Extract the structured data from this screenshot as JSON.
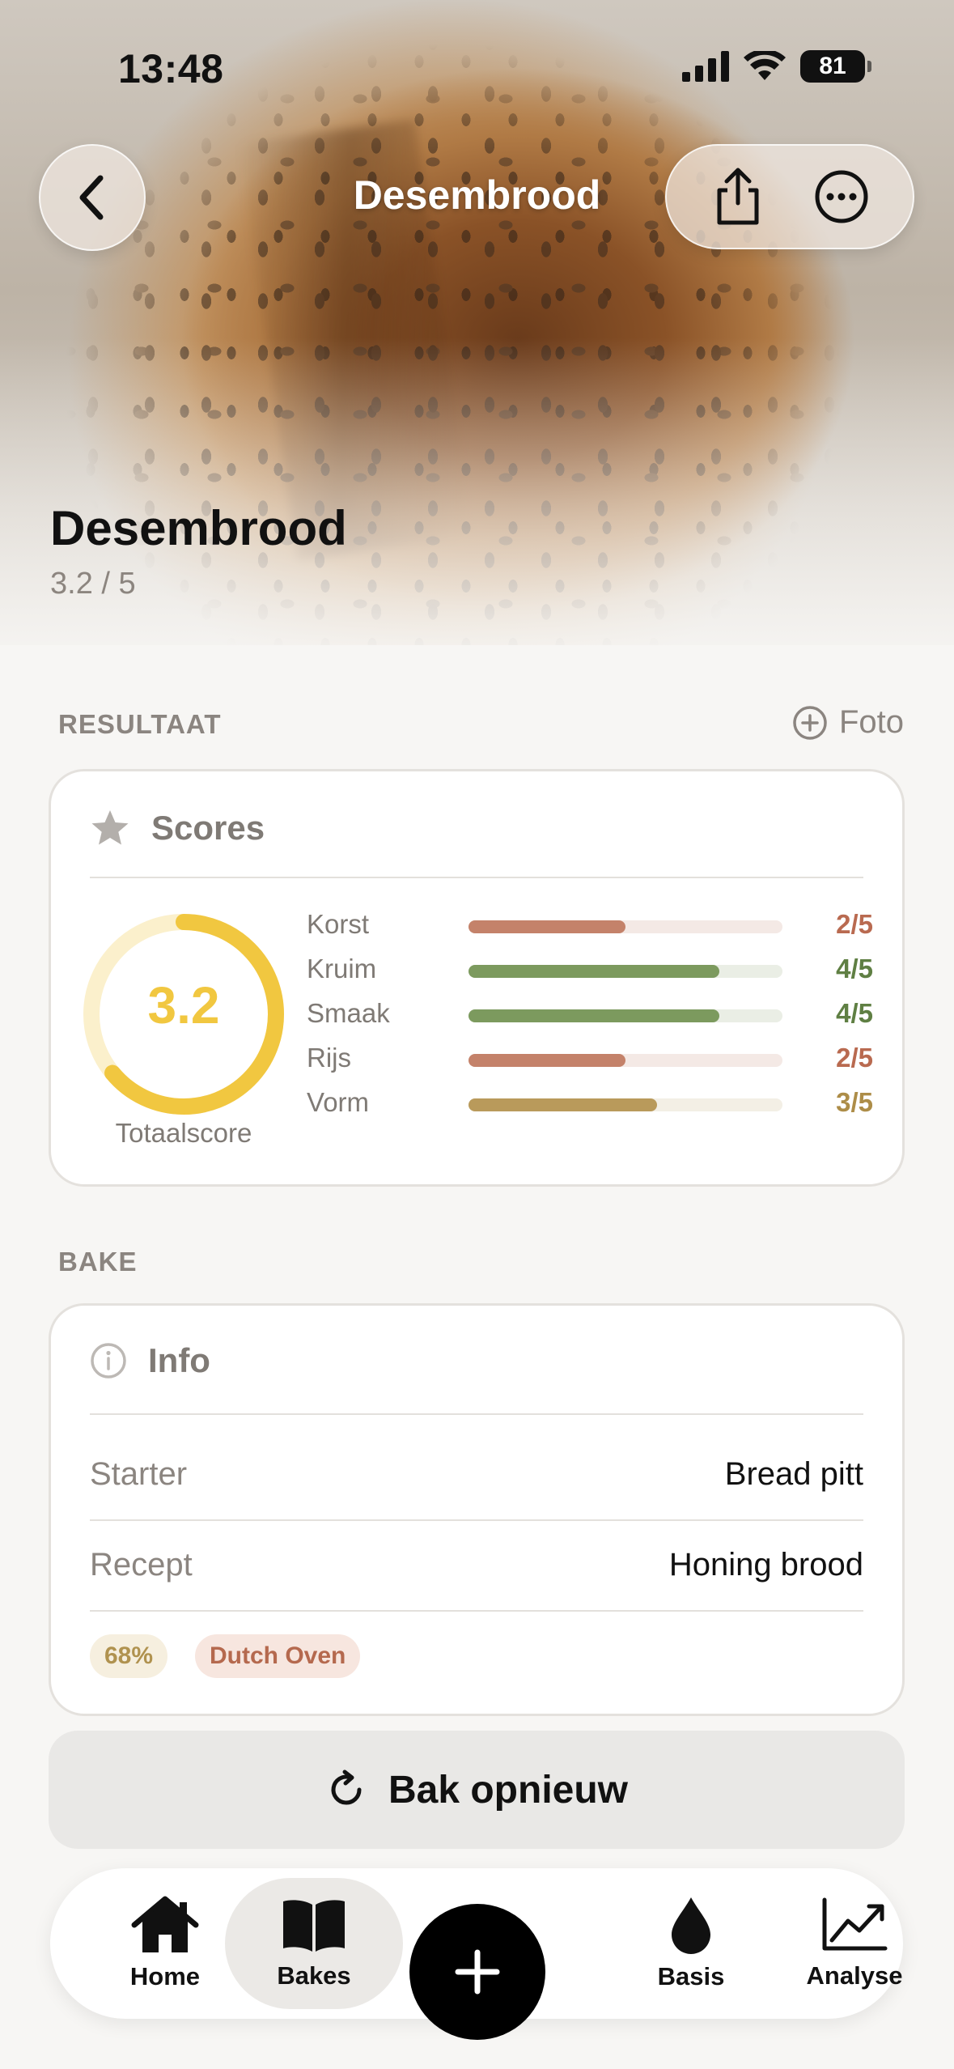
{
  "status_bar": {
    "time": "13:48",
    "battery": "81"
  },
  "nav": {
    "title": "Desembrood"
  },
  "hero": {
    "title": "Desembrood",
    "subtitle": "3.2 / 5"
  },
  "result_section": {
    "label": "RESULTAAT",
    "foto_label": "Foto",
    "scores_card": {
      "title": "Scores",
      "total": "3.2",
      "total_fraction": 0.64,
      "total_label": "Totaalscore",
      "rows": [
        {
          "name": "Korst",
          "value": "2/5",
          "fraction": 0.5,
          "color": "#c4826a",
          "track": "#f4e9e5"
        },
        {
          "name": "Kruim",
          "value": "4/5",
          "fraction": 0.8,
          "color": "#7c9a5e",
          "track": "#eaeee5"
        },
        {
          "name": "Smaak",
          "value": "4/5",
          "fraction": 0.8,
          "color": "#7c9a5e",
          "track": "#eaeee5"
        },
        {
          "name": "Rijs",
          "value": "2/5",
          "fraction": 0.5,
          "color": "#c4826a",
          "track": "#f4e9e5"
        },
        {
          "name": "Vorm",
          "value": "3/5",
          "fraction": 0.6,
          "color": "#b99a5b",
          "track": "#f3efe5"
        }
      ]
    }
  },
  "bake_section": {
    "label": "BAKE",
    "info_card": {
      "title": "Info",
      "rows": [
        {
          "key": "Starter",
          "value": "Bread pitt"
        },
        {
          "key": "Recept",
          "value": "Honing brood"
        }
      ],
      "tags": [
        {
          "label": "68%",
          "text_color": "#b0924f",
          "bg": "#f6efdf"
        },
        {
          "label": "Dutch Oven",
          "text_color": "#b5694e",
          "bg": "#f7e6df"
        }
      ]
    }
  },
  "rebake_button": {
    "label": "Bak opnieuw"
  },
  "tabbar": {
    "tabs": [
      {
        "label": "Home",
        "icon": "house-icon"
      },
      {
        "label": "Bakes",
        "icon": "book-icon",
        "active": true
      },
      {
        "label": "Basis",
        "icon": "drop-icon"
      },
      {
        "label": "Analyse",
        "icon": "chart-icon"
      }
    ],
    "fab_icon": "plus-icon"
  },
  "colors": {
    "accent_yellow": "#f1c740",
    "ring_track": "#fbf0cc"
  }
}
